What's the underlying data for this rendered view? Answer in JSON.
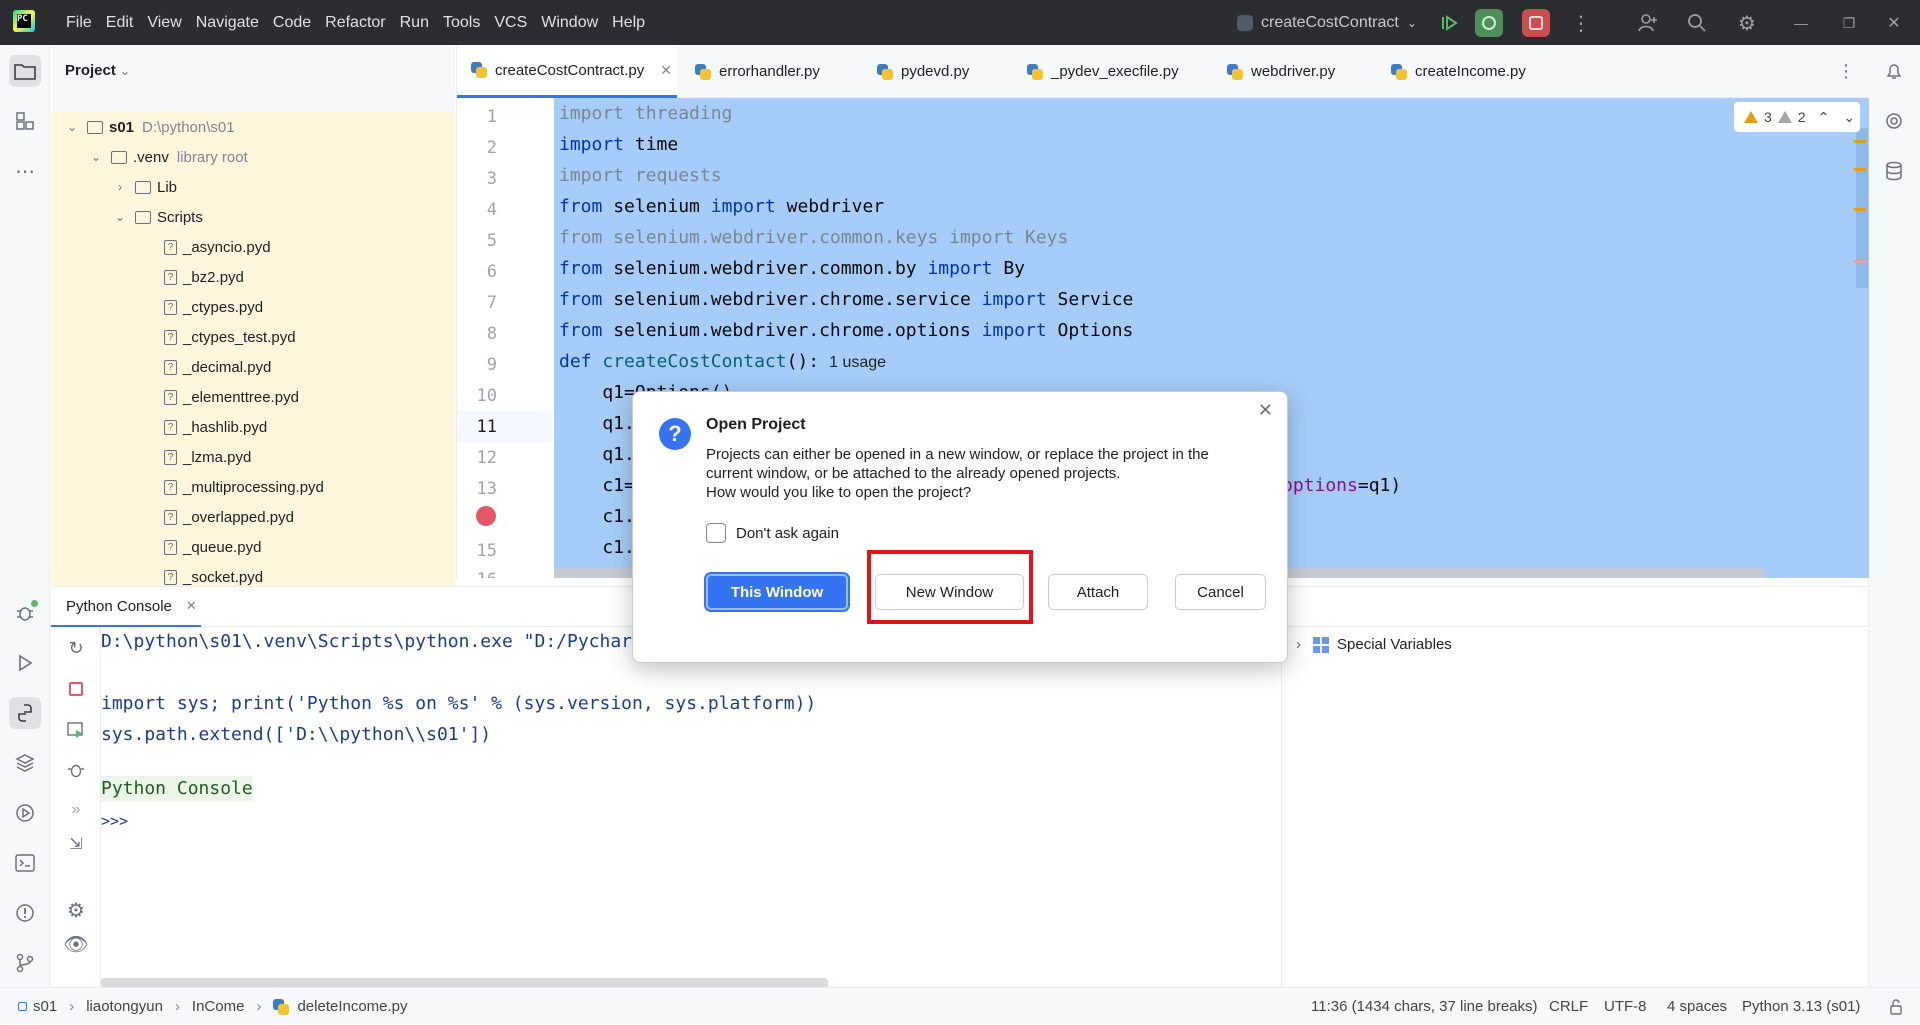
{
  "menu": [
    "File",
    "Edit",
    "View",
    "Navigate",
    "Code",
    "Refactor",
    "Run",
    "Tools",
    "VCS",
    "Window",
    "Help"
  ],
  "run_config": "createCostContract",
  "project_panel": {
    "title": "Project",
    "tree": [
      {
        "name": "s01",
        "extra": "D:\\python\\s01",
        "type": "root"
      },
      {
        "name": ".venv",
        "extra": "library root",
        "type": "folder"
      },
      {
        "name": "Lib",
        "type": "folder"
      },
      {
        "name": "Scripts",
        "type": "folder"
      },
      {
        "name": "_asyncio.pyd",
        "type": "file"
      },
      {
        "name": "_bz2.pyd",
        "type": "file"
      },
      {
        "name": "_ctypes.pyd",
        "type": "file"
      },
      {
        "name": "_ctypes_test.pyd",
        "type": "file"
      },
      {
        "name": "_decimal.pyd",
        "type": "file"
      },
      {
        "name": "_elementtree.pyd",
        "type": "file"
      },
      {
        "name": "_hashlib.pyd",
        "type": "file"
      },
      {
        "name": "_lzma.pyd",
        "type": "file"
      },
      {
        "name": "_multiprocessing.pyd",
        "type": "file"
      },
      {
        "name": "_overlapped.pyd",
        "type": "file"
      },
      {
        "name": "_queue.pyd",
        "type": "file"
      },
      {
        "name": "_socket.pyd",
        "type": "file"
      }
    ]
  },
  "tabs": [
    "createCostContract.py",
    "errorhandler.py",
    "pydevd.py",
    "_pydev_execfile.py",
    "webdriver.py",
    "createIncome.py"
  ],
  "warnings": {
    "warn_count": "3",
    "weak_count": "2"
  },
  "line_numbers": [
    "1",
    "2",
    "3",
    "4",
    "5",
    "6",
    "7",
    "8",
    "9",
    "10",
    "11",
    "12",
    "13",
    "14",
    "15",
    "16"
  ],
  "code": {
    "l1": [
      "import threading"
    ],
    "l2": [
      "import",
      " time"
    ],
    "l3": [
      "import requests"
    ],
    "l4": [
      "from",
      " selenium ",
      "import",
      " webdriver"
    ],
    "l5": [
      "from selenium.webdriver.common.keys import Keys"
    ],
    "l6": [
      "from",
      " selenium.webdriver.common.by ",
      "import",
      " By"
    ],
    "l7": [
      "from",
      " selenium.webdriver.chrome.service ",
      "import",
      " Service"
    ],
    "l8": [
      "from",
      " selenium.webdriver.chrome.options ",
      "import",
      " Options"
    ],
    "l9": [
      "def ",
      "createCostContact",
      "():"
    ],
    "l9_usage": "1 usage",
    "l10": "    q1=Options()",
    "l11": "    q1.",
    "l12": "    q1.",
    "l13a": "    c1=",
    "l13b": "options",
    "l13c": "=q1)",
    "l14": "    c1.",
    "l15": "    c1.",
    "l16": "    # "
  },
  "console": {
    "tab_label": "Python Console",
    "lines": [
      "D:\\python\\s01\\.venv\\Scripts\\python.exe \"D:/Pycharm/PyCharm 2024.3.4/plugins/python-ce/helpers/pydev/pydevco",
      "import sys; print('Python %s on %s' % (sys.version, sys.platform))",
      "sys.path.extend(['D:\\\\python\\\\s01'])",
      "Python Console",
      ">>>"
    ],
    "special_variables": "Special Variables"
  },
  "dialog": {
    "title": "Open Project",
    "message_l1": "Projects can either be opened in a new window, or replace the project in the",
    "message_l2": "current window, or be attached to the already opened projects.",
    "message_l3": "How would you like to open the project?",
    "checkbox": "Don't ask again",
    "btn_this": "This Window",
    "btn_new": "New Window",
    "btn_attach": "Attach",
    "btn_cancel": "Cancel"
  },
  "status": {
    "breadcrumbs": [
      "s01",
      "liaotongyun",
      "InCome",
      "deleteIncome.py"
    ],
    "position": "11:36 (1434 chars, 37 line breaks)",
    "line_sep": "CRLF",
    "encoding": "UTF-8",
    "indent": "4 spaces",
    "interpreter": "Python 3.13 (s01)"
  }
}
